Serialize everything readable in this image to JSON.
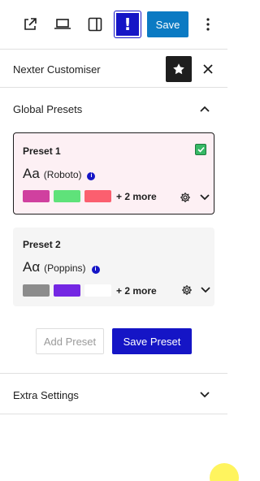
{
  "toolbar": {
    "external_icon": "external-link-icon",
    "desktop_icon": "desktop-icon",
    "sidebar_icon": "sidebar-toggle-icon",
    "alert_label": "!",
    "save_label": "Save",
    "more_icon": "more-vertical-icon"
  },
  "panel": {
    "title": "Nexter Customiser",
    "star_icon": "star-icon",
    "close_icon": "close-icon"
  },
  "global_presets": {
    "title": "Global Presets",
    "expanded": true,
    "presets": [
      {
        "name": "Preset 1",
        "selected": true,
        "font_sample": "Aa",
        "font_name": "(Roboto)",
        "info": "i",
        "colors": [
          "#d0409f",
          "#5fe27a",
          "#fb5f6f"
        ],
        "more_label": "+ 2 more"
      },
      {
        "name": "Preset 2",
        "selected": false,
        "font_sample": "Aα",
        "font_name": "(Poppins)",
        "info": "i",
        "colors": [
          "#8c8c8c",
          "#7427e3",
          "#ffffff"
        ],
        "more_label": "+ 2 more"
      }
    ],
    "add_preset_label": "Add Preset",
    "save_preset_label": "Save Preset"
  },
  "extra_settings": {
    "title": "Extra Settings",
    "expanded": false
  },
  "colors": {
    "accent_blue": "#1515c6",
    "save_blue": "#0b7ac3",
    "selected_card_bg": "#fdf0f4",
    "checkbox_green": "#36b865"
  }
}
